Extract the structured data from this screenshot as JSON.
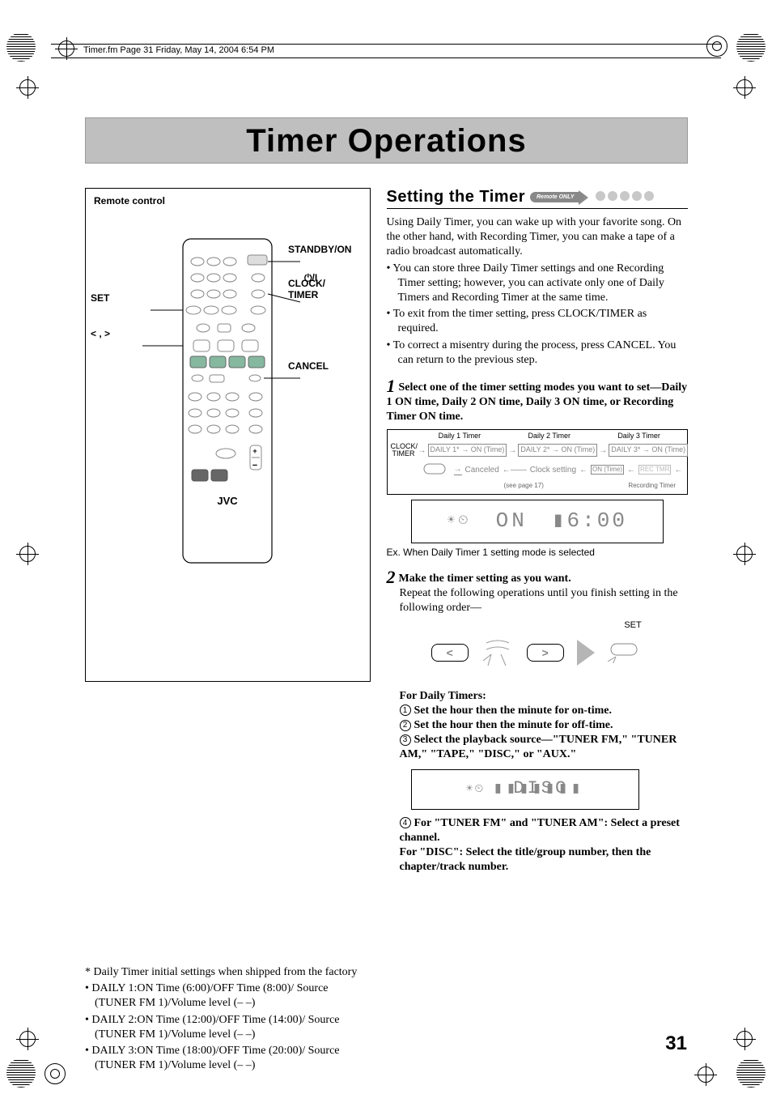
{
  "header_meta": "Timer.fm  Page 31  Friday, May 14, 2004  6:54 PM",
  "title": "Timer Operations",
  "remote": {
    "label": "Remote control",
    "callouts": {
      "set": "SET",
      "arrows": "< , >",
      "standby": "STANDBY/ON",
      "clock_timer": "CLOCK/\nTIMER",
      "cancel": "CANCEL"
    },
    "brand": "JVC"
  },
  "footnotes": {
    "star": "* Daily Timer initial settings when shipped from the factory",
    "items": [
      "• DAILY 1:ON Time (6:00)/OFF Time (8:00)/ Source (TUNER FM 1)/Volume level (– –)",
      "• DAILY 2:ON Time (12:00)/OFF Time (14:00)/ Source (TUNER FM 1)/Volume level (– –)",
      "• DAILY 3:ON Time (18:00)/OFF Time (20:00)/ Source (TUNER FM 1)/Volume level (– –)"
    ]
  },
  "section": {
    "title": "Setting the Timer",
    "badge": "Remote ONLY"
  },
  "intro": "Using Daily Timer, you can wake up with your favorite song. On the other hand, with Recording Timer, you can make a tape of a radio broadcast automatically.",
  "intro_bullets": [
    "• You can store three Daily Timer settings and one Recording Timer setting; however, you can activate only one of Daily Timers and Recording Timer at the same time.",
    "• To exit from the timer setting, press CLOCK/TIMER as required.",
    "• To correct a misentry during the process, press CANCEL. You can return to the previous step."
  ],
  "step1": {
    "head": "Select one of the timer setting modes you want to set—Daily 1 ON time, Daily 2 ON time, Daily 3 ON time, or Recording Timer ON time.",
    "flow_top": [
      "Daily 1 Timer",
      "Daily 2 Timer",
      "Daily 3 Timer"
    ],
    "flow_main": [
      "DAILY 1* → ON (Time)",
      "DAILY 2* → ON (Time)",
      "DAILY 3* → ON (Time)"
    ],
    "flow2_left": "Canceled",
    "flow2_mid": "Clock setting",
    "flow2_mid_note": "(see page 17)",
    "flow2_chip": "ON (Time)",
    "flow2_rec": "REC TMR",
    "flow_rec_label": "Recording Timer",
    "clock_label": "CLOCK/\nTIMER",
    "lcd": {
      "left": "ON",
      "right": "6:00"
    },
    "caption": "Ex. When Daily Timer 1 setting mode is selected"
  },
  "step2": {
    "head": "Make the timer setting as you want.",
    "note": "Repeat the following operations until you finish setting in the following order—",
    "set_label": "SET",
    "daily_head": "For Daily Timers:",
    "items": [
      "Set the hour then the minute for on-time.",
      "Set the hour then the minute for off-time.",
      "Select the playback source—\"TUNER FM,\" \"TUNER AM,\" \"TAPE,\" \"DISC,\" or \"AUX.\""
    ],
    "lcd2": "DISC",
    "item4": "For \"TUNER FM\" and \"TUNER AM\": Select a preset channel.\nFor \"DISC\": Select the title/group number, then the chapter/track number."
  },
  "page_number": "31"
}
